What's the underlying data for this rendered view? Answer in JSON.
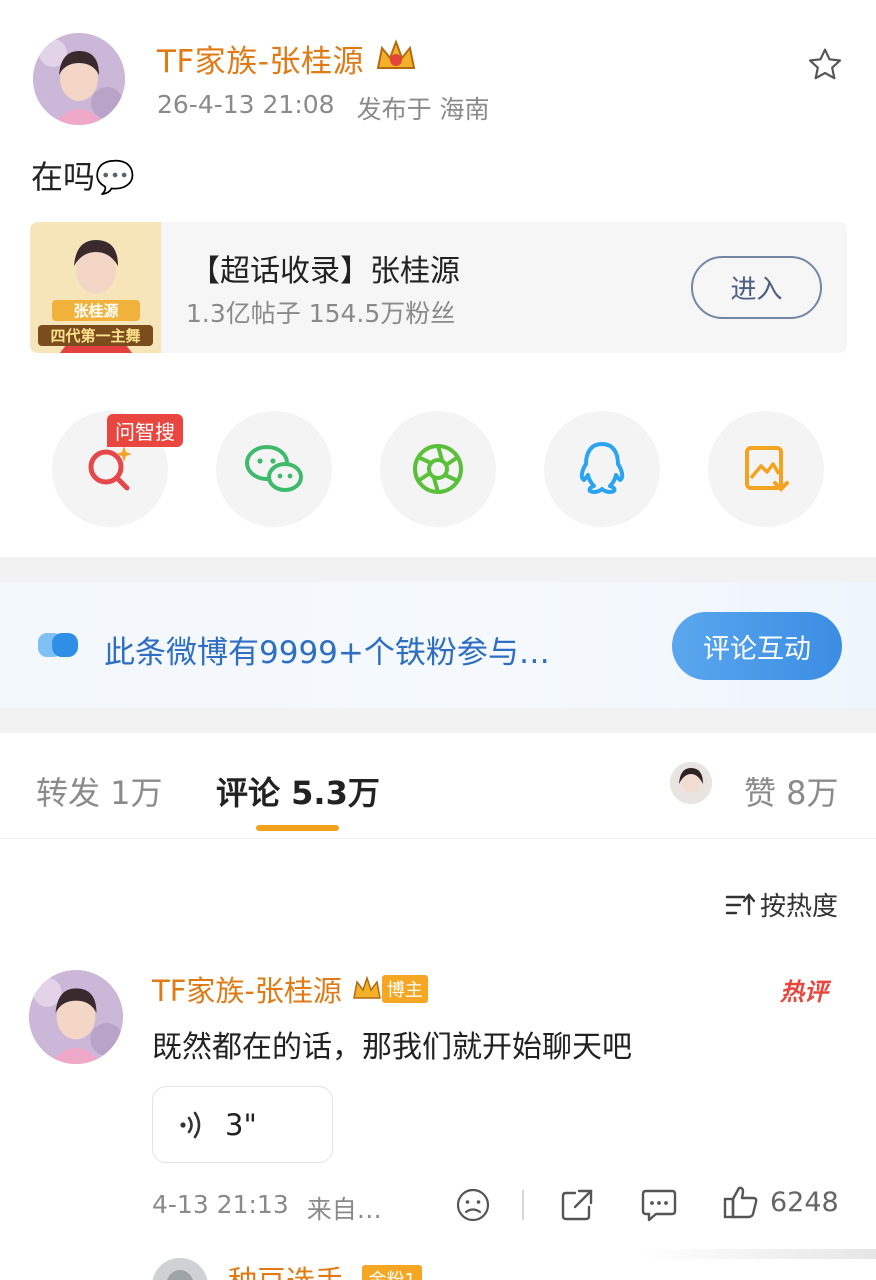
{
  "post": {
    "author_name": "TF家族-张桂源",
    "timestamp": "26-4-13 21:08",
    "location_label": "发布于 海南",
    "text": "在吗💬",
    "favorite_icon": "star-outline-icon"
  },
  "topic_card": {
    "title": "【超话收录】张桂源",
    "stats": "1.3亿帖子 154.5万粉丝",
    "enter_label": "进入",
    "thumb_caption_1": "张桂源",
    "thumb_caption_2": "四代第一主舞"
  },
  "share_actions": [
    {
      "icon": "ai-search-icon",
      "badge": "问智搜"
    },
    {
      "icon": "wechat-icon"
    },
    {
      "icon": "moments-icon"
    },
    {
      "icon": "qq-icon"
    },
    {
      "icon": "save-image-icon"
    }
  ],
  "fan_banner": {
    "text": "此条微博有9999+个铁粉参与…",
    "button_label": "评论互动"
  },
  "tabs": {
    "repost": "转发 1万",
    "comments": "评论 5.3万",
    "likes": "赞 8万"
  },
  "sort_label": "按热度",
  "comment": {
    "author_name": "TF家族-张桂源",
    "host_tag": "博主",
    "hot_tag": "热评",
    "text": "既然都在的话，那我们就开始聊天吧",
    "voice_duration": "3\"",
    "timestamp": "4-13 21:13",
    "source": "来自…",
    "like_count": "6248"
  },
  "next_comment": {
    "author_name_partial": "种豆选手-",
    "tag_partial": "金粉1"
  },
  "colors": {
    "name_orange": "#e07a14",
    "link_blue": "#2f6fc2",
    "accent_tab": "#f2a21a",
    "hot_red": "#e8463e"
  }
}
